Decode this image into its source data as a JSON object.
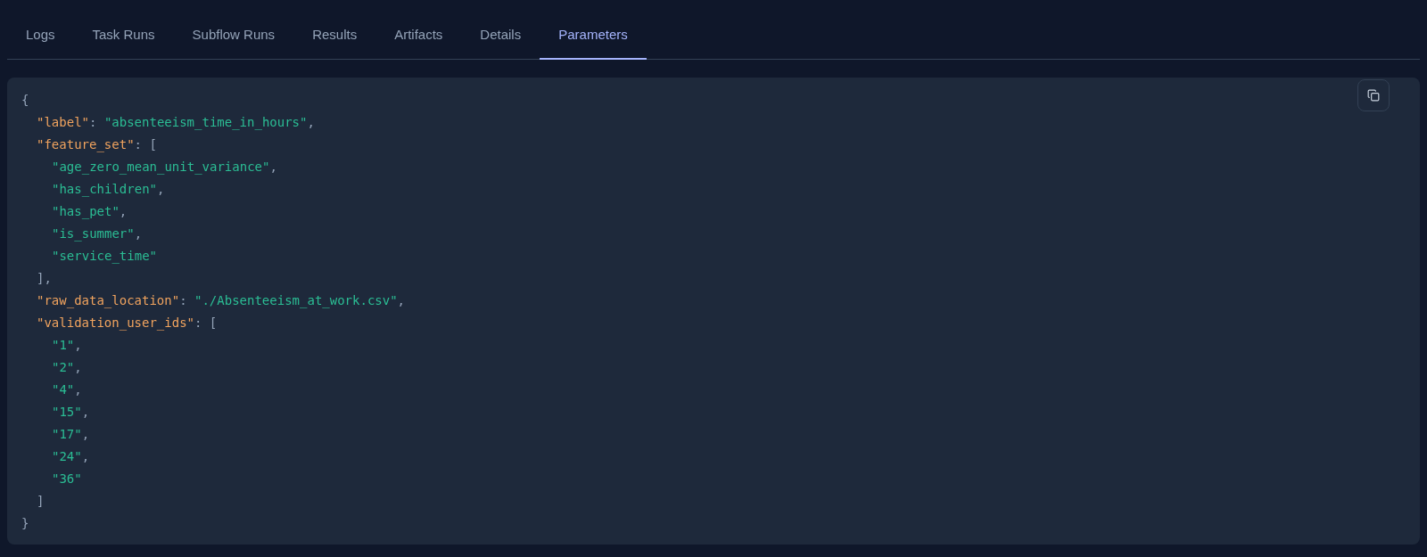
{
  "tabs": [
    {
      "label": "Logs",
      "selected": false
    },
    {
      "label": "Task Runs",
      "selected": false
    },
    {
      "label": "Subflow Runs",
      "selected": false
    },
    {
      "label": "Results",
      "selected": false
    },
    {
      "label": "Artifacts",
      "selected": false
    },
    {
      "label": "Details",
      "selected": false
    },
    {
      "label": "Parameters",
      "selected": true
    }
  ],
  "code": {
    "lines": [
      {
        "tokens": [
          {
            "kind": "punct",
            "text": "{"
          }
        ],
        "children": [
          {
            "tokens": [
              {
                "kind": "key",
                "text": "\"label\""
              },
              {
                "kind": "punct",
                "text": ": "
              },
              {
                "kind": "string",
                "text": "\"absenteeism_time_in_hours\""
              },
              {
                "kind": "punct",
                "text": ","
              }
            ]
          },
          {
            "tokens": [
              {
                "kind": "key",
                "text": "\"feature_set\""
              },
              {
                "kind": "punct",
                "text": ": ["
              }
            ],
            "children": [
              {
                "tokens": [
                  {
                    "kind": "string",
                    "text": "\"age_zero_mean_unit_variance\""
                  },
                  {
                    "kind": "punct",
                    "text": ","
                  }
                ]
              },
              {
                "tokens": [
                  {
                    "kind": "string",
                    "text": "\"has_children\""
                  },
                  {
                    "kind": "punct",
                    "text": ","
                  }
                ]
              },
              {
                "tokens": [
                  {
                    "kind": "string",
                    "text": "\"has_pet\""
                  },
                  {
                    "kind": "punct",
                    "text": ","
                  }
                ]
              },
              {
                "tokens": [
                  {
                    "kind": "string",
                    "text": "\"is_summer\""
                  },
                  {
                    "kind": "punct",
                    "text": ","
                  }
                ]
              },
              {
                "tokens": [
                  {
                    "kind": "string",
                    "text": "\"service_time\""
                  }
                ]
              }
            ]
          },
          {
            "tokens": [
              {
                "kind": "punct",
                "text": "],"
              }
            ]
          },
          {
            "tokens": [
              {
                "kind": "key",
                "text": "\"raw_data_location\""
              },
              {
                "kind": "punct",
                "text": ": "
              },
              {
                "kind": "string",
                "text": "\"./Absenteeism_at_work.csv\""
              },
              {
                "kind": "punct",
                "text": ","
              }
            ]
          },
          {
            "tokens": [
              {
                "kind": "key",
                "text": "\"validation_user_ids\""
              },
              {
                "kind": "punct",
                "text": ": ["
              }
            ],
            "children": [
              {
                "tokens": [
                  {
                    "kind": "string",
                    "text": "\"1\""
                  },
                  {
                    "kind": "punct",
                    "text": ","
                  }
                ]
              },
              {
                "tokens": [
                  {
                    "kind": "string",
                    "text": "\"2\""
                  },
                  {
                    "kind": "punct",
                    "text": ","
                  }
                ]
              },
              {
                "tokens": [
                  {
                    "kind": "string",
                    "text": "\"4\""
                  },
                  {
                    "kind": "punct",
                    "text": ","
                  }
                ]
              },
              {
                "tokens": [
                  {
                    "kind": "string",
                    "text": "\"15\""
                  },
                  {
                    "kind": "punct",
                    "text": ","
                  }
                ]
              },
              {
                "tokens": [
                  {
                    "kind": "string",
                    "text": "\"17\""
                  },
                  {
                    "kind": "punct",
                    "text": ","
                  }
                ]
              },
              {
                "tokens": [
                  {
                    "kind": "string",
                    "text": "\"24\""
                  },
                  {
                    "kind": "punct",
                    "text": ","
                  }
                ]
              },
              {
                "tokens": [
                  {
                    "kind": "string",
                    "text": "\"36\""
                  }
                ]
              }
            ]
          },
          {
            "tokens": [
              {
                "kind": "punct",
                "text": "]"
              }
            ]
          }
        ]
      },
      {
        "tokens": [
          {
            "kind": "punct",
            "text": "}"
          }
        ]
      }
    ]
  }
}
